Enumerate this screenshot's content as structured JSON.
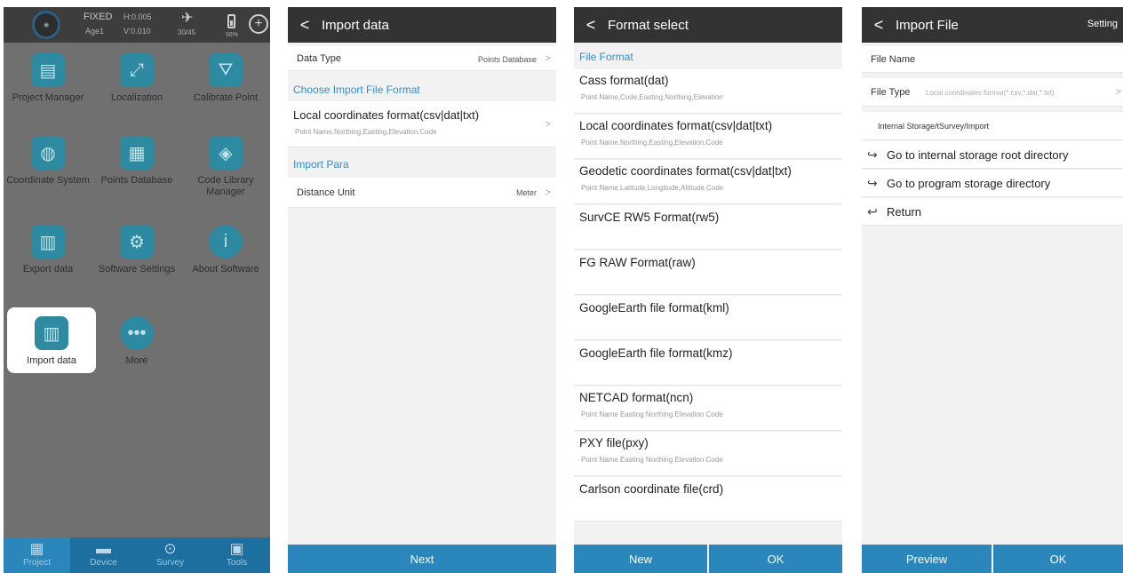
{
  "home": {
    "status": {
      "fix": "FIXED",
      "h_precision": "H:0.005",
      "age": "Age1",
      "v_precision": "V:0.010",
      "satellites": "30/45",
      "battery": "56%"
    },
    "tiles": [
      {
        "label": "Project Manager",
        "icon": "clipboard-icon"
      },
      {
        "label": "Localization",
        "icon": "axes-icon"
      },
      {
        "label": "Calibrate Point",
        "icon": "tripod-icon"
      },
      {
        "label": "Coordinate System",
        "icon": "globe-icon"
      },
      {
        "label": "Points Database",
        "icon": "database-search-icon"
      },
      {
        "label": "Code Library Manager",
        "icon": "layers-icon"
      },
      {
        "label": "Export data",
        "icon": "export-chart-icon"
      },
      {
        "label": "Software Settings",
        "icon": "gears-icon"
      },
      {
        "label": "About Software",
        "icon": "info-icon"
      },
      {
        "label": "Import data",
        "icon": "import-chart-icon"
      },
      {
        "label": "More",
        "icon": "more-dots-icon"
      }
    ],
    "nav": [
      {
        "label": "Project",
        "icon": "grid-icon"
      },
      {
        "label": "Device",
        "icon": "receiver-icon"
      },
      {
        "label": "Survey",
        "icon": "location-pin-icon"
      },
      {
        "label": "Tools",
        "icon": "toolbox-icon"
      }
    ]
  },
  "import_data": {
    "title": "Import data",
    "data_type_label": "Data Type",
    "data_type_value": "Points Database",
    "format_section": "Choose Import File Format",
    "format_title": "Local coordinates format(csv|dat|txt)",
    "format_fields": "Point Name,Northing,Easting,Elevation,Code",
    "para_section": "Import Para",
    "distance_unit_label": "Distance Unit",
    "distance_unit_value": "Meter",
    "next_button": "Next"
  },
  "format_select": {
    "title": "Format select",
    "section": "File Format",
    "items": [
      {
        "title": "Cass format(dat)",
        "sub": "Point Name,Code,Easting,Northing,Elevation"
      },
      {
        "title": "Local coordinates format(csv|dat|txt)",
        "sub": "Point Name,Northing,Easting,Elevation,Code"
      },
      {
        "title": "Geodetic coordinates format(csv|dat|txt)",
        "sub": "Point Name,Latitude,Longitude,Altitude,Code"
      },
      {
        "title": "SurvCE RW5 Format(rw5)",
        "sub": ""
      },
      {
        "title": "FG RAW Format(raw)",
        "sub": ""
      },
      {
        "title": "GoogleEarth file format(kml)",
        "sub": ""
      },
      {
        "title": "GoogleEarth file format(kmz)",
        "sub": ""
      },
      {
        "title": "NETCAD format(ncn)",
        "sub": "Point Name Easting Northing Elevation Code"
      },
      {
        "title": "PXY file(pxy)",
        "sub": "Point Name Easting Northing Elevation Code"
      },
      {
        "title": "Carlson coordinate file(crd)",
        "sub": ""
      }
    ],
    "new_button": "New",
    "ok_button": "OK"
  },
  "import_file": {
    "title": "Import File",
    "settings": "Setting",
    "file_name_label": "File Name",
    "file_type_label": "File Type",
    "file_type_value": "Local coordinates format(*.csv,*.dat,*.txt)",
    "path": "Internal Storage/tSurvey/Import",
    "nav_items": [
      {
        "label": "Go to internal storage root directory",
        "icon": "folder-jump-icon"
      },
      {
        "label": "Go to program storage directory",
        "icon": "folder-jump-icon"
      },
      {
        "label": "Return",
        "icon": "return-icon"
      }
    ],
    "preview_button": "Preview",
    "ok_button": "OK"
  }
}
